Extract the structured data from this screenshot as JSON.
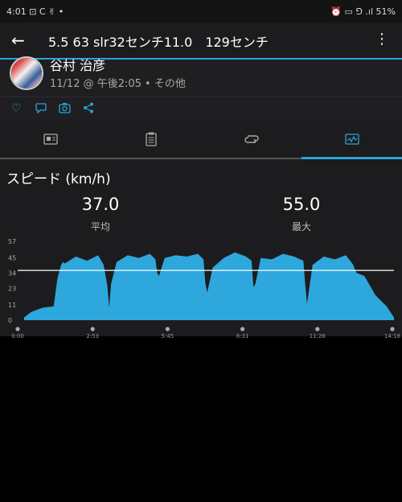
{
  "status_bar": {
    "time": "4:01",
    "left_icons": "⊡ C ✌ •",
    "right_icons": "⏰ ▭ ⅁ .ıl",
    "battery": "51%"
  },
  "app_bar": {
    "title": "5.5 63 slr32センチ11.0　129センチ"
  },
  "activity": {
    "athlete_name": "谷村 治彦",
    "meta": "11/12 @ 午後2:05 • その他"
  },
  "actions": [
    "like",
    "comment",
    "photo",
    "share"
  ],
  "tabs": [
    {
      "name": "summary",
      "icon": "summary-icon"
    },
    {
      "name": "details",
      "icon": "clipboard-icon"
    },
    {
      "name": "laps",
      "icon": "loop-icon"
    },
    {
      "name": "charts",
      "icon": "chart-icon",
      "selected": true
    }
  ],
  "chart_section": {
    "title": "スピード (km/h)",
    "stats": [
      {
        "value": "37.0",
        "label": "平均"
      },
      {
        "value": "55.0",
        "label": "最大"
      }
    ]
  },
  "chart_data": {
    "type": "area",
    "title": "スピード (km/h)",
    "yticks": [
      "57",
      "45",
      "34",
      "23",
      "11",
      "0"
    ],
    "ytick_values": [
      57,
      45,
      34,
      23,
      11,
      0
    ],
    "xticks": [
      "0:00",
      "2:53",
      "5:45",
      "8:31",
      "11:26",
      "14:18"
    ],
    "ylim": [
      0,
      57
    ],
    "average_line": 36,
    "color": "#2ea7dd",
    "x_fraction": [
      0,
      0.02,
      0.05,
      0.08,
      0.09,
      0.1,
      0.105,
      0.11,
      0.14,
      0.17,
      0.2,
      0.215,
      0.225,
      0.23,
      0.235,
      0.25,
      0.28,
      0.31,
      0.34,
      0.355,
      0.36,
      0.365,
      0.38,
      0.41,
      0.44,
      0.47,
      0.485,
      0.49,
      0.495,
      0.51,
      0.54,
      0.57,
      0.6,
      0.615,
      0.62,
      0.625,
      0.64,
      0.67,
      0.7,
      0.73,
      0.755,
      0.76,
      0.765,
      0.78,
      0.81,
      0.84,
      0.87,
      0.89,
      0.895,
      0.9,
      0.92,
      0.95,
      0.98,
      1.0
    ],
    "y_values": [
      2,
      6,
      9,
      10,
      30,
      40,
      42,
      41,
      46,
      43,
      47,
      40,
      25,
      9,
      26,
      42,
      47,
      45,
      48,
      44,
      34,
      32,
      45,
      47,
      46,
      48,
      44,
      27,
      20,
      38,
      45,
      49,
      46,
      43,
      24,
      26,
      45,
      44,
      48,
      46,
      43,
      26,
      12,
      40,
      46,
      44,
      47,
      40,
      36,
      34,
      32,
      18,
      10,
      2
    ]
  }
}
